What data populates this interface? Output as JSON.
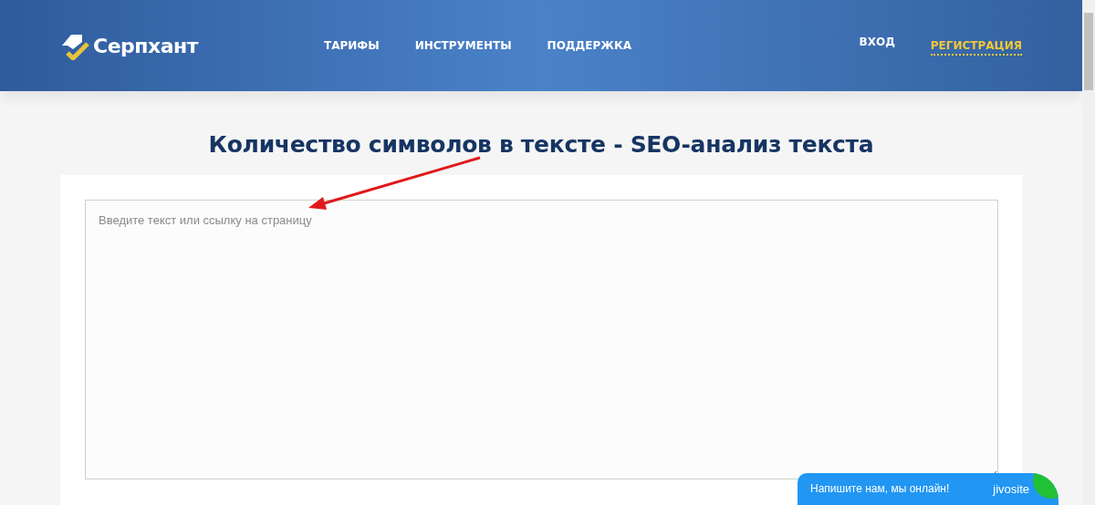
{
  "header": {
    "logo": "Серпхант",
    "nav": [
      {
        "label": "ТАРИФЫ"
      },
      {
        "label": "ИНСТРУМЕНТЫ"
      },
      {
        "label": "ПОДДЕРЖКА"
      }
    ],
    "account": [
      {
        "label": "ВХОД",
        "kind": "plain"
      },
      {
        "label": "РЕГИСТРАЦИЯ",
        "kind": "accent"
      }
    ]
  },
  "title": "Количество символов в тексте - SEO-анализ текста",
  "text_input": {
    "placeholder": "Введите текст или ссылку на страницу"
  },
  "chat_widget": {
    "message": "Напишите нам, мы онлайн!",
    "brand": "jivosite"
  }
}
